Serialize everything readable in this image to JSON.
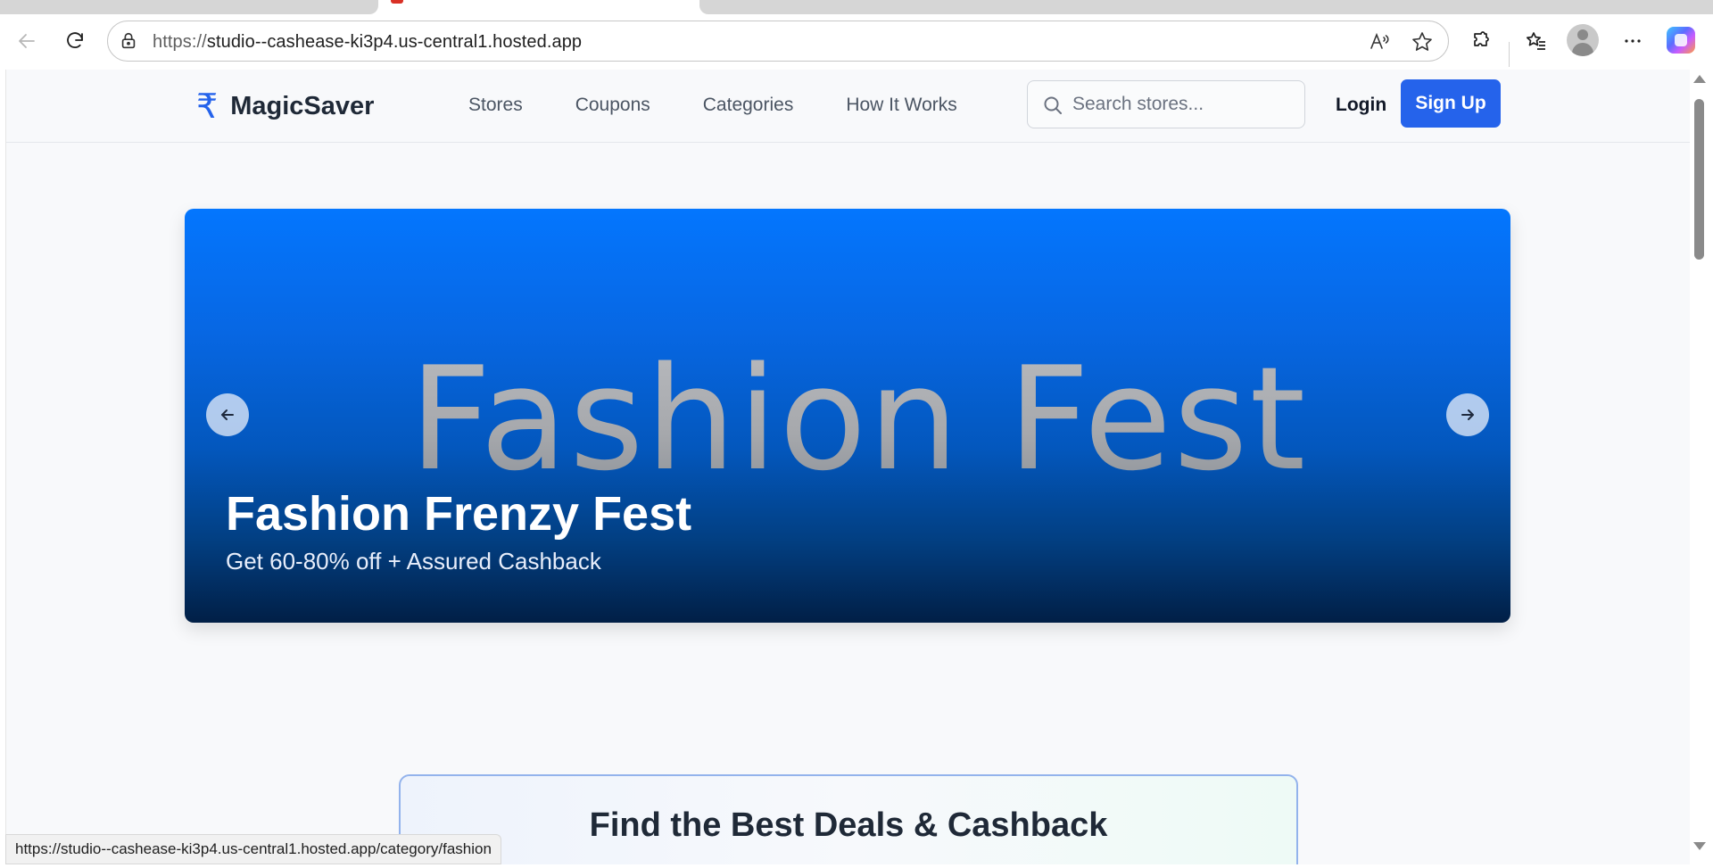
{
  "browser": {
    "url_protocol": "https://",
    "url_rest": "studio--cashease-ki3p4.us-central1.hosted.app",
    "status_url": "https://studio--cashease-ki3p4.us-central1.hosted.app/category/fashion"
  },
  "site": {
    "logo_symbol": "₹",
    "brand": "MagicSaver",
    "nav": [
      "Stores",
      "Coupons",
      "Categories",
      "How It Works"
    ],
    "search_placeholder": "Search stores...",
    "login_label": "Login",
    "signup_label": "Sign Up"
  },
  "hero": {
    "image_text": "Fashion Fest",
    "title": "Fashion Frenzy Fest",
    "subtitle": "Get 60-80% off + Assured Cashback"
  },
  "deals": {
    "title": "Find the Best Deals & Cashback"
  },
  "colors": {
    "brand_blue": "#2563eb",
    "hero_top": "#0476fe",
    "hero_bottom": "#011f46"
  }
}
